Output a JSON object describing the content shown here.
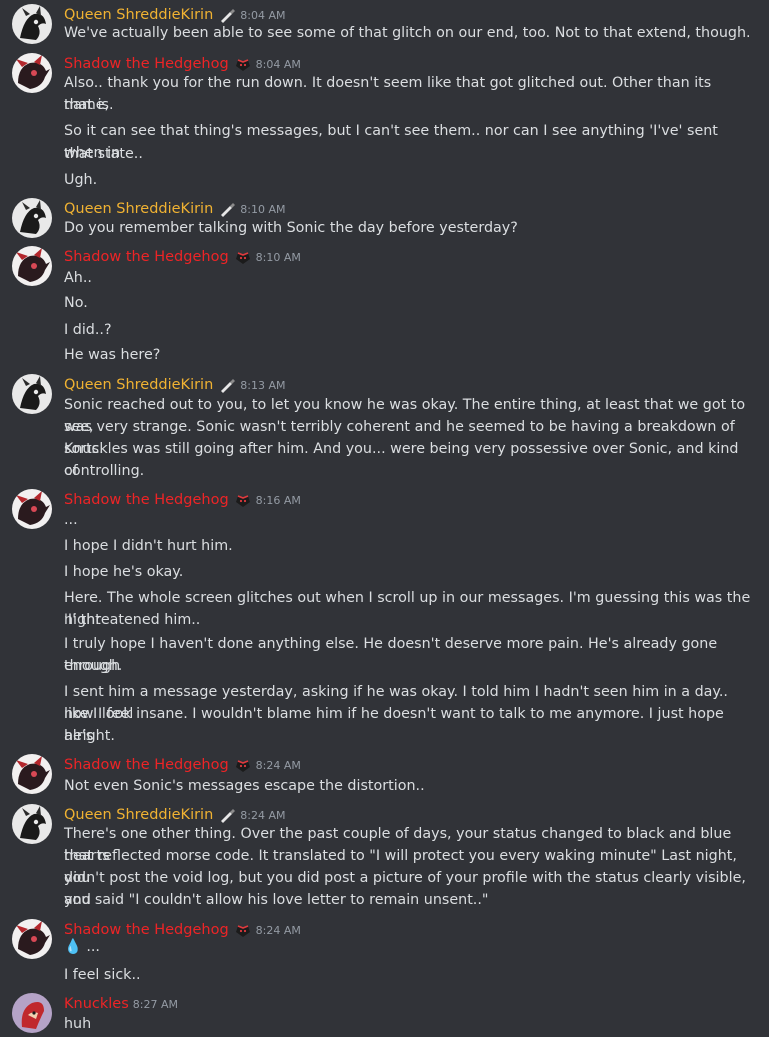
{
  "users": {
    "queen": {
      "name": "Queen ShreddieKirin",
      "color": "#f0b232"
    },
    "shadow": {
      "name": "Shadow the Hedgehog",
      "color": "#ed2426"
    },
    "knuckles": {
      "name": "Knuckles",
      "color": "#ed2426"
    }
  },
  "messages": [
    {
      "user": "Queen ShreddieKirin",
      "time": "8:04 AM",
      "lines": [
        "We've actually been able to see some of that glitch on our end, too. Not to that extend, though."
      ]
    },
    {
      "user": "Shadow the Hedgehog",
      "time": "8:04 AM",
      "lines": [
        "Also.. thank you for the run down. It doesn't seem like that got glitched out. Other than its name,",
        "that is.",
        "So it can see that thing's messages, but I can't see them.. nor can I see anything 'I've' sent when in",
        "that state..",
        "Ugh."
      ]
    },
    {
      "user": "Queen ShreddieKirin",
      "time": "8:10 AM",
      "lines": [
        "Do you remember talking with Sonic the day before yesterday?"
      ]
    },
    {
      "user": "Shadow the Hedgehog",
      "time": "8:10 AM",
      "lines": [
        "Ah..",
        "No.",
        "I did..?",
        "He was here?"
      ]
    },
    {
      "user": "Queen ShreddieKirin",
      "time": "8:13 AM",
      "lines": [
        "Sonic reached out to you, to let you know he was okay. The entire thing, at least that we got to see,",
        "was very strange. Sonic wasn't terribly coherent and he seemed to be having a breakdown of sorts.",
        "Knuckles was still going after him. And you... were being very possessive over Sonic, and kind of",
        "controlling."
      ]
    },
    {
      "user": "Shadow the Hedgehog",
      "time": "8:16 AM",
      "lines": [
        "...",
        "I hope I didn't hurt him.",
        "I hope he's okay.",
        "Here. The whole screen glitches out when I scroll up in our messages. I'm guessing this was the night",
        "'I' threatened him..",
        "I truly hope I haven't done anything else. He doesn't deserve more pain. He's already gone through",
        "enough.",
        "I sent him a message yesterday, asking if he was okay. I told him I hadn't seen him in a day.. now I feel",
        "like I look insane. I wouldn't blame him if he doesn't want to talk to me anymore. I just hope he's",
        "alright."
      ]
    },
    {
      "user": "Shadow the Hedgehog",
      "time": "8:24 AM",
      "lines": [
        "Not even Sonic's messages escape the distortion.."
      ]
    },
    {
      "user": "Queen ShreddieKirin",
      "time": "8:24 AM",
      "lines": [
        "There's one other thing. Over the past couple of days, your status changed to black and blue hearts",
        "that reflected morse code. It translated to \"I will protect you every waking minute\" Last night, you",
        "didn't post the void log, but you did post a picture of your profile with the status clearly visible, and",
        "you said \"I couldn't allow his love letter to remain unsent..\""
      ]
    },
    {
      "user": "Shadow the Hedgehog",
      "time": "8:24 AM",
      "lines": [
        "💧 ...",
        "I feel sick.."
      ]
    },
    {
      "user": "Knuckles",
      "time": "8:27 AM",
      "lines": [
        "huh"
      ]
    }
  ]
}
